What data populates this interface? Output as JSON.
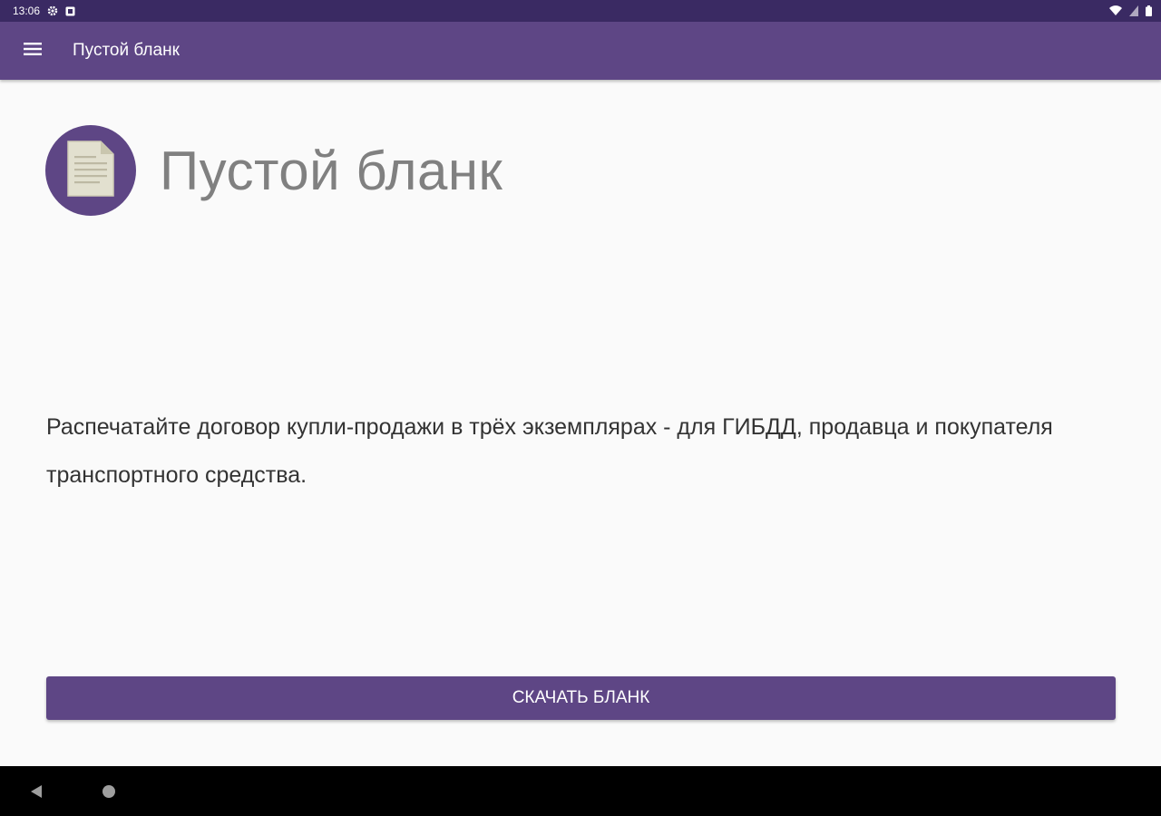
{
  "status_bar": {
    "time": "13:06",
    "icons": [
      "settings-icon",
      "notification-icon",
      "wifi-icon",
      "signal-icon",
      "battery-icon"
    ]
  },
  "app_bar": {
    "title": "Пустой бланк",
    "menu_icon": "menu-icon"
  },
  "main": {
    "icon": "document-icon",
    "heading": "Пустой бланк",
    "description": "Распечатайте договор купли-продажи в трёх экземплярах - для ГИБДД, продавца и покупателя транспортного средства.",
    "download_label": "СКАЧАТЬ БЛАНК"
  },
  "nav_bar": {
    "icons": [
      "back-icon",
      "home-icon"
    ]
  },
  "colors": {
    "primary": "#5e4685",
    "primary_dark": "#3a2a63",
    "background": "#fafafa"
  }
}
